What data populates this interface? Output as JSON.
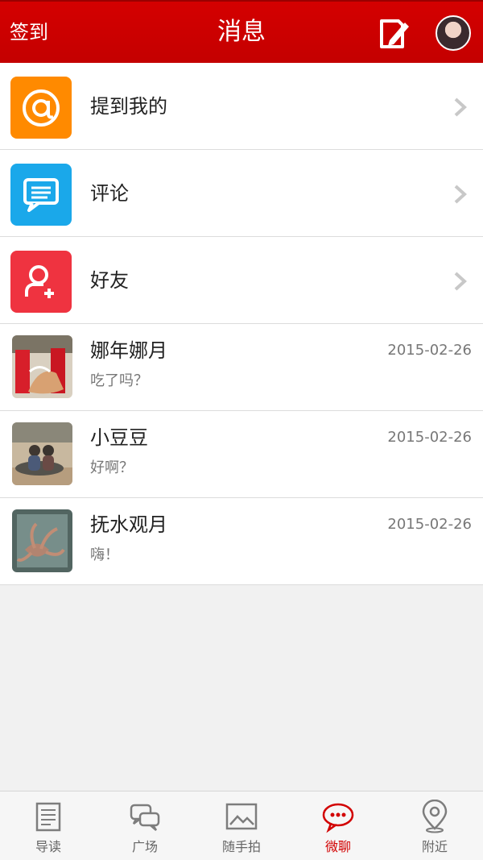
{
  "header": {
    "left_action": "签到",
    "title": "消息",
    "compose_icon": "edit-icon",
    "avatar_icon": "user-avatar"
  },
  "menu": [
    {
      "label": "提到我的",
      "icon": "at-icon",
      "color": "#ff8a00"
    },
    {
      "label": "评论",
      "icon": "comment-icon",
      "color": "#1aa8ea"
    },
    {
      "label": "好友",
      "icon": "add-friend-icon",
      "color": "#ef3340"
    }
  ],
  "chats": [
    {
      "name": "娜年娜月",
      "message": "吃了吗？",
      "date": "2015-02-26"
    },
    {
      "name": "小豆豆",
      "message": "好啊？",
      "date": "2015-02-26"
    },
    {
      "name": "抚水观月",
      "message": "嗨！",
      "date": "2015-02-26"
    }
  ],
  "tabs": [
    {
      "label": "导读",
      "icon": "newspaper-icon"
    },
    {
      "label": "广场",
      "icon": "chat-bubbles-icon"
    },
    {
      "label": "随手拍",
      "icon": "image-icon"
    },
    {
      "label": "微聊",
      "icon": "message-icon",
      "active": true
    },
    {
      "label": "附近",
      "icon": "location-icon"
    }
  ],
  "colors": {
    "accent": "#d20000",
    "background": "#f1f1f1"
  }
}
